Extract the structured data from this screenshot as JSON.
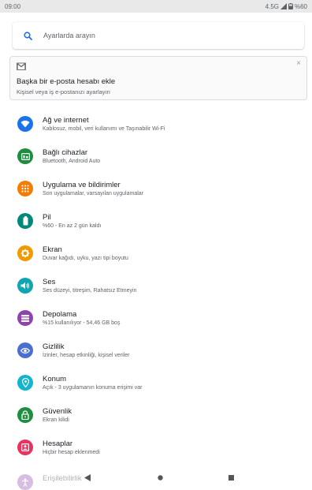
{
  "status_bar": {
    "time": "09:00",
    "network": "4.5G",
    "battery": "%60"
  },
  "search": {
    "placeholder": "Ayarlarda arayın"
  },
  "suggestion": {
    "title": "Başka bir e-posta hesabı ekle",
    "subtitle": "Kişisel veya iş e-postanızı ayarlayın",
    "close_label": "×"
  },
  "colors": {
    "network": "#1a73e8",
    "devices": "#1e8e3e",
    "apps": "#f57c00",
    "battery": "#00897b",
    "display": "#f29900",
    "sound": "#12a4af",
    "storage": "#8e44ad",
    "privacy": "#4a6fd1",
    "location": "#12b5cb",
    "security": "#1e8e3e",
    "accounts": "#e8335f",
    "accessibility": "#8e44ad"
  },
  "settings": [
    {
      "title": "Ağ ve internet",
      "subtitle": "Kablosuz, mobil, veri kullanımı ve Taşınabilir Wi-Fi",
      "icon": "wifi-icon"
    },
    {
      "title": "Bağlı cihazlar",
      "subtitle": "Bluetooth, Android Auto",
      "icon": "devices-icon"
    },
    {
      "title": "Uygulama ve bildirimler",
      "subtitle": "Son uygulamalar, varsayılan uygulamalar",
      "icon": "apps-icon"
    },
    {
      "title": "Pil",
      "subtitle": "%60 - En az 2 gün kaldı",
      "icon": "battery-icon"
    },
    {
      "title": "Ekran",
      "subtitle": "Duvar kağıdı, uyku, yazı tipi boyutu",
      "icon": "brightness-icon"
    },
    {
      "title": "Ses",
      "subtitle": "Ses düzeyi, titreşim, Rahatsız Etmeyin",
      "icon": "volume-icon"
    },
    {
      "title": "Depolama",
      "subtitle": "%15 kullanılıyor - 54,46 GB boş",
      "icon": "storage-icon"
    },
    {
      "title": "Gizlilik",
      "subtitle": "İzinler, hesap etkinliği, kişisel veriler",
      "icon": "privacy-icon"
    },
    {
      "title": "Konum",
      "subtitle": "Açık - 3 uygulamanın konuma erişimi var",
      "icon": "location-icon"
    },
    {
      "title": "Güvenlik",
      "subtitle": "Ekran kilidi",
      "icon": "lock-icon"
    },
    {
      "title": "Hesaplar",
      "subtitle": "Hiçbir hesap eklenmedi",
      "icon": "accounts-icon"
    }
  ],
  "partial_setting": {
    "title": "Erişilebilirlik",
    "icon": "accessibility-icon"
  }
}
